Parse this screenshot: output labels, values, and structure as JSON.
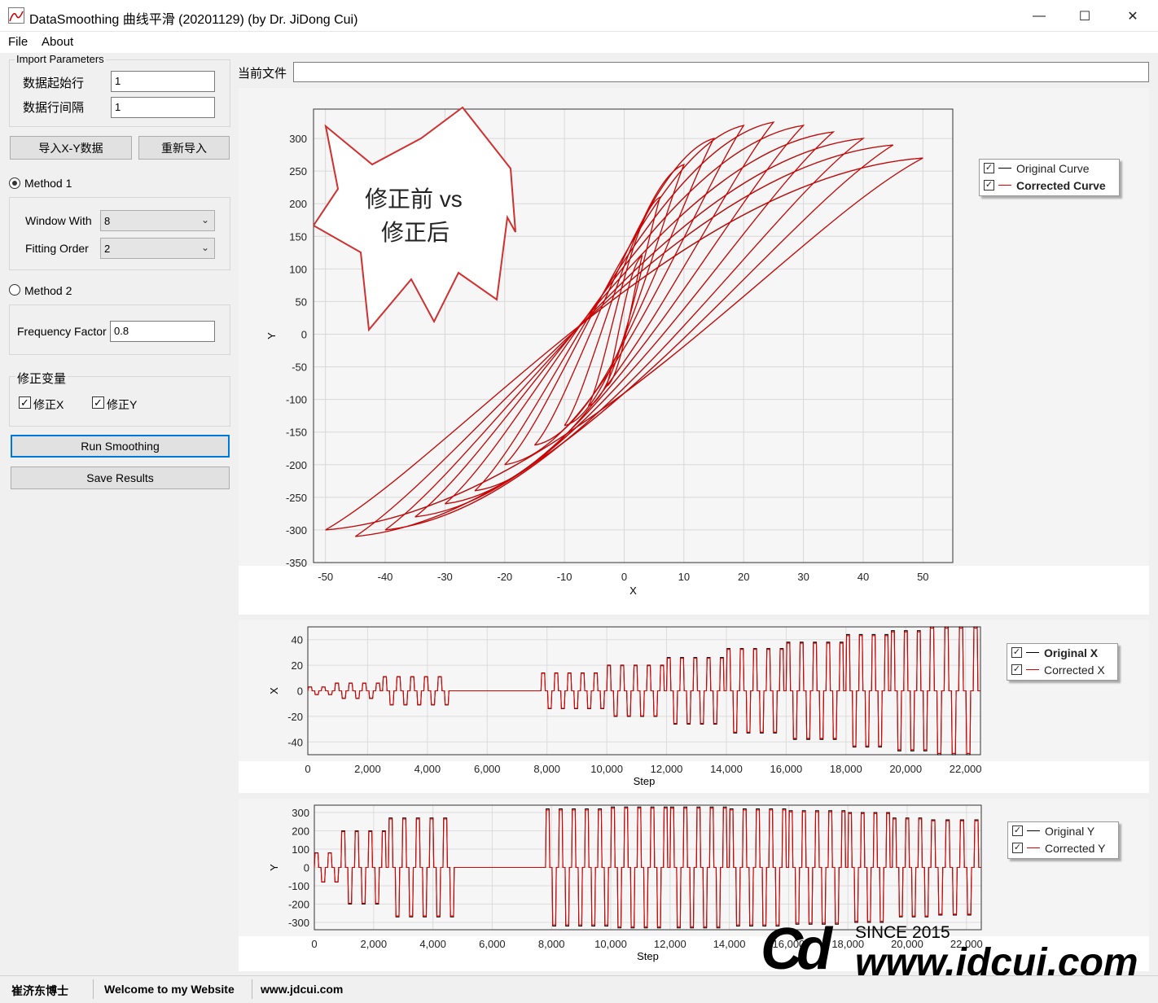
{
  "window": {
    "title": "DataSmoothing 曲线平滑 (20201129) (by Dr. JiDong Cui)",
    "min": "—",
    "max": "☐",
    "close": "✕"
  },
  "menu": {
    "file": "File",
    "about": "About"
  },
  "import_params": {
    "legend": "Import Parameters",
    "start_row_label": "数据起始行",
    "start_row_value": "1",
    "row_interval_label": "数据行间隔",
    "row_interval_value": "1",
    "import_button": "导入X-Y数据",
    "reimport_button": "重新导入"
  },
  "method1": {
    "label": "Method 1",
    "window_label": "Window With",
    "window_value": "8",
    "order_label": "Fitting Order",
    "order_value": "2"
  },
  "method2": {
    "label": "Method 2",
    "freq_label": "Frequency Factor",
    "freq_value": "0.8"
  },
  "correct": {
    "legend": "修正变量",
    "x_label": "修正X",
    "y_label": "修正Y",
    "check": "✓"
  },
  "run_button": "Run Smoothing",
  "save_button": "Save Results",
  "current_file_label": "当前文件",
  "current_file_value": "",
  "callout": {
    "line1": "修正前 vs",
    "line2": "修正后"
  },
  "colors": {
    "original": "#000000",
    "corrected": "#e00000",
    "callout_border": "#d03030"
  },
  "chart_data": [
    {
      "type": "line",
      "xlabel": "X",
      "ylabel": "Y",
      "xlim": [
        -52,
        55
      ],
      "ylim": [
        -350,
        345
      ],
      "xticks": [
        -50,
        -40,
        -30,
        -20,
        -10,
        0,
        10,
        20,
        30,
        40,
        50
      ],
      "yticks": [
        300,
        250,
        200,
        150,
        100,
        50,
        0,
        -50,
        -100,
        -150,
        -200,
        -250,
        -300,
        -350
      ],
      "legend": [
        "Original Curve",
        "Corrected Curve"
      ],
      "legend_position": "right",
      "grid": true,
      "series": [
        {
          "name": "Original Curve",
          "loops": [
            [
              -50,
              -300,
              50,
              270
            ],
            [
              -45,
              -310,
              45,
              290
            ],
            [
              -40,
              -300,
              40,
              300
            ],
            [
              -35,
              -280,
              35,
              310
            ],
            [
              -30,
              -260,
              30,
              320
            ],
            [
              -25,
              -240,
              25,
              325
            ],
            [
              -20,
              -200,
              20,
              320
            ],
            [
              -15,
              -170,
              15,
              300
            ],
            [
              -10,
              -140,
              10,
              260
            ],
            [
              -6,
              -110,
              6,
              210
            ],
            [
              -3,
              -80,
              3,
              120
            ]
          ]
        },
        {
          "name": "Corrected Curve",
          "loops": [
            [
              -50,
              -300,
              50,
              270
            ],
            [
              -45,
              -310,
              45,
              290
            ],
            [
              -40,
              -300,
              40,
              300
            ],
            [
              -35,
              -280,
              35,
              310
            ],
            [
              -30,
              -260,
              30,
              320
            ],
            [
              -25,
              -240,
              25,
              325
            ],
            [
              -20,
              -200,
              20,
              320
            ],
            [
              -15,
              -170,
              15,
              300
            ],
            [
              -10,
              -140,
              10,
              260
            ],
            [
              -6,
              -110,
              6,
              210
            ],
            [
              -3,
              -80,
              3,
              120
            ]
          ]
        }
      ]
    },
    {
      "type": "line",
      "xlabel": "Step",
      "ylabel": "X",
      "xlim": [
        0,
        22500
      ],
      "ylim": [
        -50,
        50
      ],
      "xticks": [
        0,
        2000,
        4000,
        6000,
        8000,
        10000,
        12000,
        14000,
        16000,
        18000,
        20000,
        22000
      ],
      "xtick_labels": [
        "0",
        "2,000",
        "4,000",
        "6,000",
        "8,000",
        "10,000",
        "12,000",
        "14,000",
        "16,000",
        "18,000",
        "20,000",
        "22,000"
      ],
      "yticks": [
        40,
        20,
        0,
        -20,
        -40
      ],
      "legend": [
        "Original X",
        "Corrected X"
      ],
      "cycles": [
        [
          0,
          900,
          3
        ],
        [
          900,
          2500,
          6
        ],
        [
          2500,
          4800,
          11
        ],
        [
          4800,
          7800,
          0
        ],
        [
          7800,
          10000,
          14
        ],
        [
          10000,
          12000,
          20
        ],
        [
          12000,
          14000,
          26
        ],
        [
          14000,
          16000,
          33
        ],
        [
          16000,
          18000,
          38
        ],
        [
          18000,
          19500,
          44
        ],
        [
          19500,
          20800,
          47
        ],
        [
          20800,
          22500,
          50
        ]
      ]
    },
    {
      "type": "line",
      "xlabel": "Step",
      "ylabel": "Y",
      "xlim": [
        0,
        22500
      ],
      "ylim": [
        -340,
        340
      ],
      "xticks": [
        0,
        2000,
        4000,
        6000,
        8000,
        10000,
        12000,
        14000,
        16000,
        18000,
        20000,
        22000
      ],
      "xtick_labels": [
        "0",
        "2,000",
        "4,000",
        "6,000",
        "8,000",
        "10,000",
        "12,000",
        "14,000",
        "16,000",
        "18,000",
        "20,000",
        "22,000"
      ],
      "yticks": [
        300,
        200,
        100,
        0,
        -100,
        -200,
        -300
      ],
      "legend": [
        "Original Y",
        "Corrected Y"
      ],
      "cycles": [
        [
          0,
          900,
          80
        ],
        [
          900,
          2500,
          200
        ],
        [
          2500,
          4800,
          270
        ],
        [
          4800,
          7800,
          0
        ],
        [
          7800,
          10000,
          320
        ],
        [
          10000,
          12000,
          330
        ],
        [
          12000,
          14000,
          330
        ],
        [
          14000,
          16000,
          320
        ],
        [
          16000,
          18000,
          310
        ],
        [
          18000,
          19500,
          300
        ],
        [
          19500,
          20800,
          270
        ],
        [
          20800,
          22500,
          260
        ]
      ]
    }
  ],
  "watermark": {
    "logo": "Cd",
    "since": "SINCE 2015",
    "url": "www.jdcui.com"
  },
  "status": {
    "name": "崔济东博士",
    "welcome": "Welcome to my Website",
    "site": "www.jdcui.com"
  }
}
